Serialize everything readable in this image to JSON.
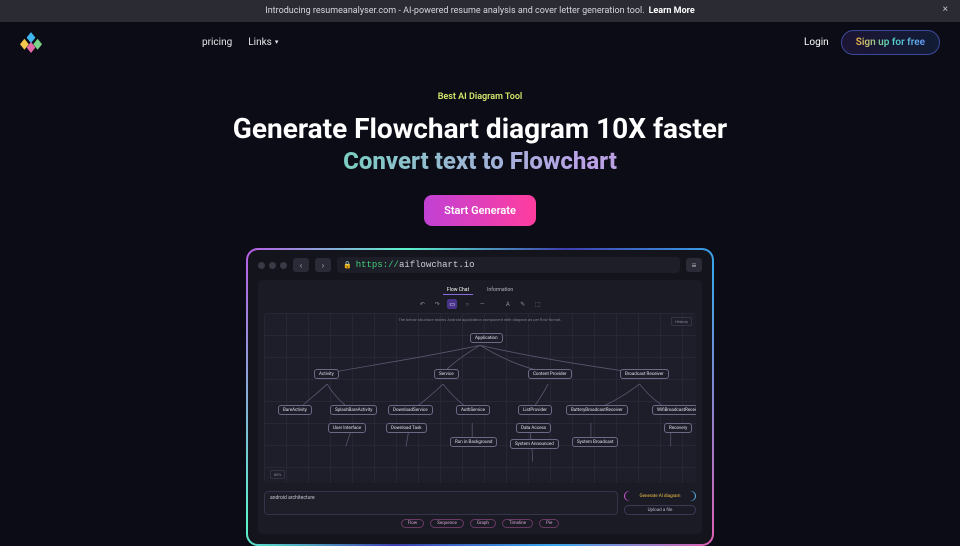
{
  "announcement": {
    "text": "Introducing resumeanalyser.com - AI-powered resume analysis and cover letter generation tool.",
    "cta": "Learn More",
    "close": "×"
  },
  "nav": {
    "links": {
      "pricing": "pricing",
      "links": "Links"
    },
    "login": "Login",
    "signup": "Sign up for free"
  },
  "hero": {
    "badge": "Best AI Diagram Tool",
    "headline": "Generate Flowchart diagram 10X faster",
    "subhead": "Convert text to Flowchart",
    "cta": "Start Generate"
  },
  "preview": {
    "url_proto": "https://",
    "url_host": "aiflowchart.io",
    "tabs": {
      "flow": "Flow Chat",
      "info": "Information"
    },
    "tools": [
      "↶",
      "↷",
      "▭",
      "○",
      "—",
      "·",
      "A",
      "✎",
      "⬚"
    ],
    "sidebar_label": "History",
    "caption": "The below structure shows Android application component with diagram as per flow format.",
    "nodes": {
      "root": "Application",
      "activity": "Activity",
      "service": "Service",
      "content": "Content Provider",
      "broadcast": "Broadcast Receiver",
      "bare": "BareActivity",
      "splash": "SplashBareActivity",
      "download": "DownloadService",
      "auth": "AuthService",
      "list": "ListProvider",
      "battery": "BatteryBroadcastReceiver",
      "wifi": "WifiBroadcastReceiver",
      "userint": "User Interface",
      "downloadt": "Download Task",
      "runinbg": "Run in Background",
      "dataacc": "Data Access",
      "systeman": "System Announced",
      "systembc": "System Broadcast",
      "recovery": "Recovery"
    },
    "zoom": "80%",
    "prompt_value": "android architecture",
    "generate": "Generate AI diagram",
    "upload": "Upload a file",
    "chips": [
      "Flow",
      "Sequence",
      "Graph",
      "Timeline",
      "Pie"
    ]
  }
}
